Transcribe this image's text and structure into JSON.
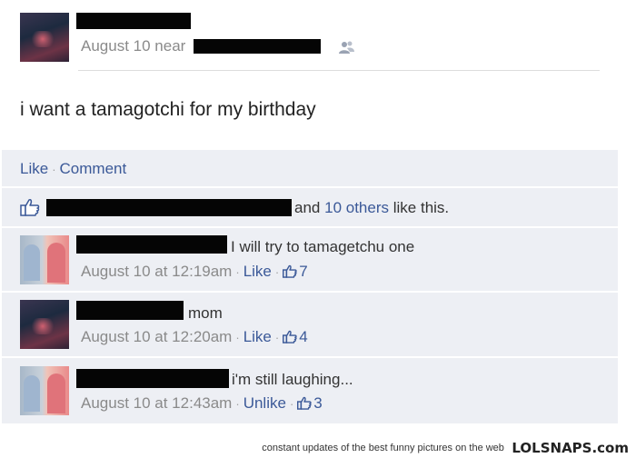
{
  "post": {
    "date_prefix": "August 10 near",
    "text": "i want a tamagotchi for my birthday",
    "actions": {
      "like": "Like",
      "separator": "·",
      "comment": "Comment"
    },
    "likes": {
      "and": "and",
      "others": "10 others",
      "suffix": "like this."
    }
  },
  "comments": [
    {
      "text": "I will try to tamagetchu one",
      "time": "August 10 at 12:19am",
      "action": "Like",
      "likes": "7"
    },
    {
      "text": "mom",
      "time": "August 10 at 12:20am",
      "action": "Like",
      "likes": "4"
    },
    {
      "text": "i'm still laughing...",
      "time": "August 10 at 12:43am",
      "action": "Unlike",
      "likes": "3"
    }
  ],
  "footer": {
    "tagline": "constant updates of the best funny pictures on the web",
    "brand": "LOLSNAPS.com"
  },
  "colors": {
    "link": "#3b5998",
    "panel": "#edeff4",
    "meta": "#8a8a8a"
  }
}
